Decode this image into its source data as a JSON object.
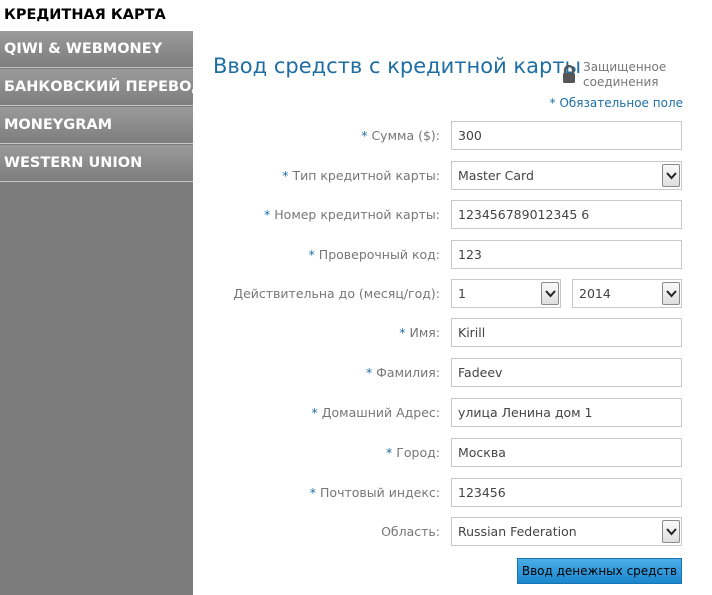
{
  "sidebar": {
    "items": [
      {
        "label": "КРЕДИТНАЯ КАРТА",
        "active": true
      },
      {
        "label": "QIWI & WEBMONEY",
        "active": false
      },
      {
        "label": "БАНКОВСКИЙ ПЕРЕВОД",
        "active": false
      },
      {
        "label": "MONEYGRAM",
        "active": false
      },
      {
        "label": "WESTERN UNION",
        "active": false
      }
    ]
  },
  "form": {
    "title": "Ввод средств с кредитной карты",
    "secure_text": "Защищенное соединения",
    "required_note": "* Обязательное поле",
    "required_marker": "*",
    "fields": {
      "amount": {
        "label": "Сумма ($):",
        "value": "300",
        "required": true
      },
      "card_type": {
        "label": "Тип кредитной карты:",
        "value": "Master Card",
        "required": true
      },
      "card_number": {
        "label": "Номер кредитной карты:",
        "value": "123456789012345 6",
        "required": true
      },
      "cvv": {
        "label": "Проверочный код:",
        "value": "123",
        "required": true
      },
      "expiry": {
        "label": "Действительна до (месяц/год):",
        "month": "1",
        "year": "2014",
        "required": false
      },
      "first_name": {
        "label": "Имя:",
        "value": "Kirill",
        "required": true
      },
      "last_name": {
        "label": "Фамилия:",
        "value": "Fadeev",
        "required": true
      },
      "address": {
        "label": "Домашний Адрес:",
        "value": "улица Ленина дом 1",
        "required": true
      },
      "city": {
        "label": "Город:",
        "value": "Москва",
        "required": true
      },
      "zip": {
        "label": "Почтовый индекс:",
        "value": "123456",
        "required": true
      },
      "region": {
        "label": "Область:",
        "value": "Russian Federation",
        "required": false
      }
    },
    "submit_label": "Ввод денежных средств"
  },
  "colors": {
    "accent": "#1f6ea3",
    "sidebar_bg": "#7b7b7b",
    "button": "#2a95d8"
  },
  "icons": {
    "secure": "lock-icon",
    "select": "chevron-down-icon"
  }
}
